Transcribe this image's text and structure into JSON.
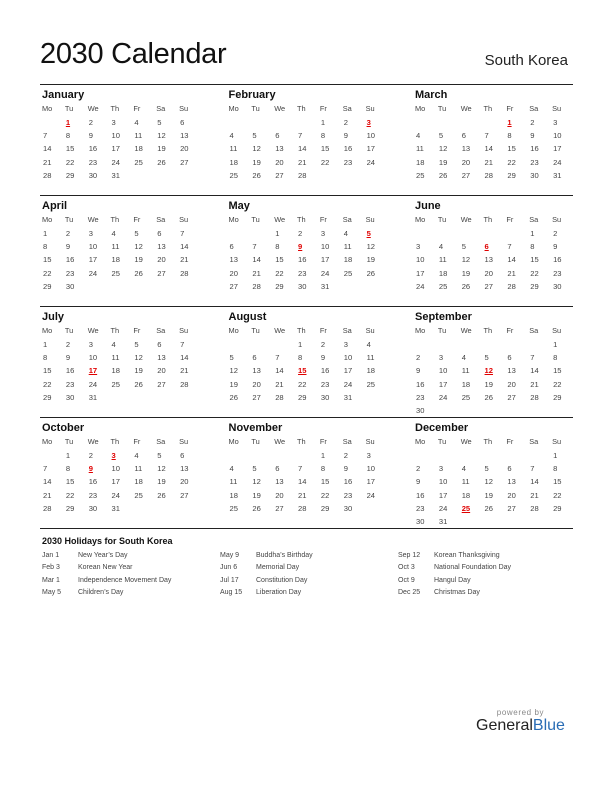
{
  "header": {
    "title": "2030 Calendar",
    "country": "South Korea"
  },
  "weekdays": [
    "Mo",
    "Tu",
    "We",
    "Th",
    "Fr",
    "Sa",
    "Su"
  ],
  "months": [
    {
      "name": "January",
      "offset": 1,
      "days": 31,
      "holidays": [
        1
      ]
    },
    {
      "name": "February",
      "offset": 4,
      "days": 28,
      "holidays": [
        3
      ]
    },
    {
      "name": "March",
      "offset": 4,
      "days": 31,
      "holidays": [
        1
      ]
    },
    {
      "name": "April",
      "offset": 0,
      "days": 30,
      "holidays": []
    },
    {
      "name": "May",
      "offset": 2,
      "days": 31,
      "holidays": [
        5,
        9
      ]
    },
    {
      "name": "June",
      "offset": 5,
      "days": 30,
      "holidays": [
        6
      ]
    },
    {
      "name": "July",
      "offset": 0,
      "days": 31,
      "holidays": [
        17
      ]
    },
    {
      "name": "August",
      "offset": 3,
      "days": 31,
      "holidays": [
        15
      ]
    },
    {
      "name": "September",
      "offset": 6,
      "days": 30,
      "holidays": [
        12
      ]
    },
    {
      "name": "October",
      "offset": 1,
      "days": 31,
      "holidays": [
        3,
        9
      ]
    },
    {
      "name": "November",
      "offset": 4,
      "days": 30,
      "holidays": []
    },
    {
      "name": "December",
      "offset": 6,
      "days": 31,
      "holidays": [
        25
      ]
    }
  ],
  "holidays_section": {
    "title": "2030 Holidays for South Korea",
    "columns": [
      [
        {
          "date": "Jan 1",
          "name": "New Year’s Day"
        },
        {
          "date": "Feb 3",
          "name": "Korean New Year"
        },
        {
          "date": "Mar 1",
          "name": "Independence Movement Day"
        },
        {
          "date": "May 5",
          "name": "Children’s Day"
        }
      ],
      [
        {
          "date": "May 9",
          "name": "Buddha’s Birthday"
        },
        {
          "date": "Jun 6",
          "name": "Memorial Day"
        },
        {
          "date": "Jul 17",
          "name": "Constitution Day"
        },
        {
          "date": "Aug 15",
          "name": "Liberation Day"
        }
      ],
      [
        {
          "date": "Sep 12",
          "name": "Korean Thanksgiving"
        },
        {
          "date": "Oct 3",
          "name": "National Foundation Day"
        },
        {
          "date": "Oct 9",
          "name": "Hangul Day"
        },
        {
          "date": "Dec 25",
          "name": "Christmas Day"
        }
      ]
    ]
  },
  "branding": {
    "powered_by": "powered by",
    "name_part1": "General",
    "name_part2": "Blue"
  },
  "colors": {
    "holiday": "#e00000",
    "brand_blue": "#2a6db5"
  }
}
